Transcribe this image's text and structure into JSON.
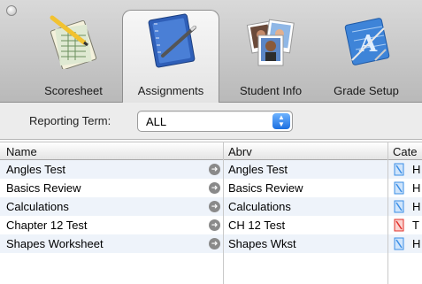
{
  "toolbar": {
    "tabs": [
      {
        "label": "Scoresheet",
        "icon": "scoresheet-icon",
        "selected": false
      },
      {
        "label": "Assignments",
        "icon": "assignments-notebook-icon",
        "selected": true
      },
      {
        "label": "Student Info",
        "icon": "student-photos-icon",
        "selected": false
      },
      {
        "label": "Grade Setup",
        "icon": "grade-setup-icon",
        "selected": false
      }
    ]
  },
  "filter": {
    "label": "Reporting Term:",
    "value": "ALL"
  },
  "table": {
    "columns": [
      "Name",
      "Abrv",
      "Cate"
    ],
    "rows": [
      {
        "name": "Angles Test",
        "abrv": "Angles Test",
        "category": "H",
        "category_color": "#3a8ee6"
      },
      {
        "name": "Basics Review",
        "abrv": "Basics Review",
        "category": "H",
        "category_color": "#3a8ee6"
      },
      {
        "name": "Calculations",
        "abrv": "Calculations",
        "category": "H",
        "category_color": "#3a8ee6"
      },
      {
        "name": "Chapter 12 Test",
        "abrv": "CH 12 Test",
        "category": "T",
        "category_color": "#e0302a"
      },
      {
        "name": "Shapes Worksheet",
        "abrv": "Shapes Wkst",
        "category": "H",
        "category_color": "#3a8ee6"
      }
    ]
  },
  "colors": {
    "selection_alt_row": "#eef3fa",
    "select_arrow": "#1b6fe0"
  }
}
